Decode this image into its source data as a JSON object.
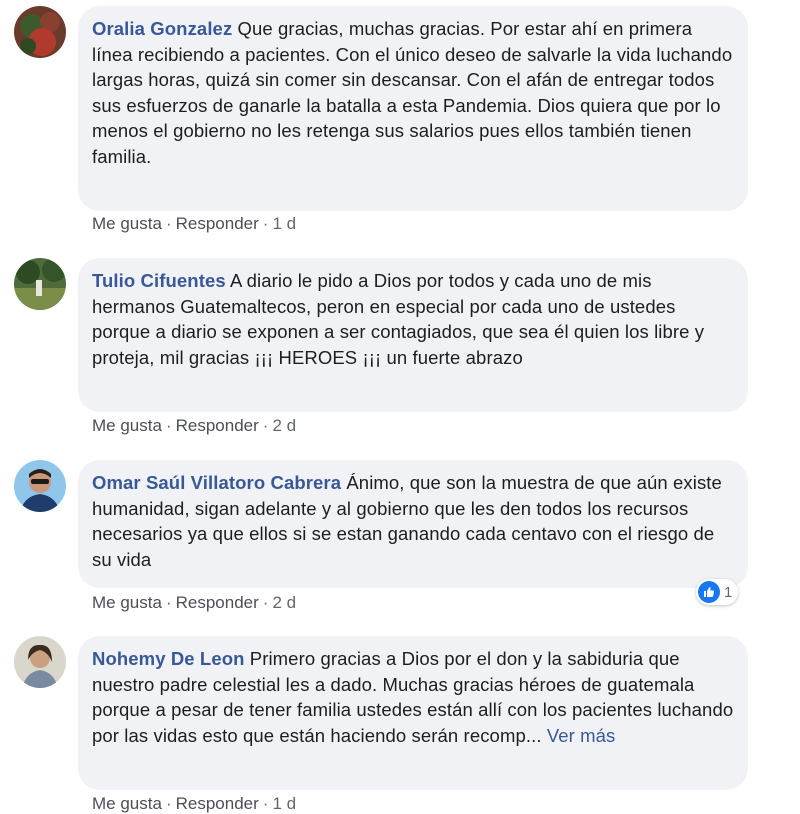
{
  "comments": [
    {
      "author": "Oralia Gonzalez",
      "text": " Que gracias, muchas gracias. Por estar ahí en primera línea recibiendo a pacientes. Con el único deseo de salvarle la vida luchando largas horas, quizá sin comer sin descansar. Con el afán de entregar todos sus esfuerzos de ganarle la batalla a esta Pandemia. Dios quiera que por lo menos el gobierno no les retenga sus salarios pues ellos también tienen familia.",
      "like_label": "Me gusta",
      "reply_label": "Responder",
      "time": "1 d"
    },
    {
      "author": "Tulio Cifuentes",
      "text": " A diario le pido a Dios por todos y cada uno de mis hermanos Guatemaltecos, peron en especial por cada uno de ustedes porque a diario se exponen a ser contagiados, que sea él quien los libre y proteja, mil gracias ¡¡¡ HEROES ¡¡¡ un fuerte abrazo",
      "like_label": "Me gusta",
      "reply_label": "Responder",
      "time": "2 d"
    },
    {
      "author": "Omar Saúl Villatoro Cabrera",
      "text": " Ánimo, que son la muestra de que aún existe humanidad, sigan adelante y al gobierno que les den todos los recursos necesarios ya que ellos si se estan ganando cada centavo con el riesgo de su vida",
      "like_label": "Me gusta",
      "reply_label": "Responder",
      "time": "2 d",
      "reaction_count": "1"
    },
    {
      "author": "Nohemy De Leon",
      "text": " Primero gracias a Dios por el don y la sabiduria que nuestro padre celestial les a dado. Muchas gracias héroes de guatemala porque a pesar de tener familia ustedes están allí con los pacientes luchando por las vidas esto que están haciendo serán recomp... ",
      "see_more": "Ver más",
      "like_label": "Me gusta",
      "reply_label": "Responder",
      "time": "1 d"
    }
  ],
  "separator": "·",
  "colors": {
    "author": "#385898",
    "bubble": "#f0f2f5",
    "like": "#1877f2"
  }
}
